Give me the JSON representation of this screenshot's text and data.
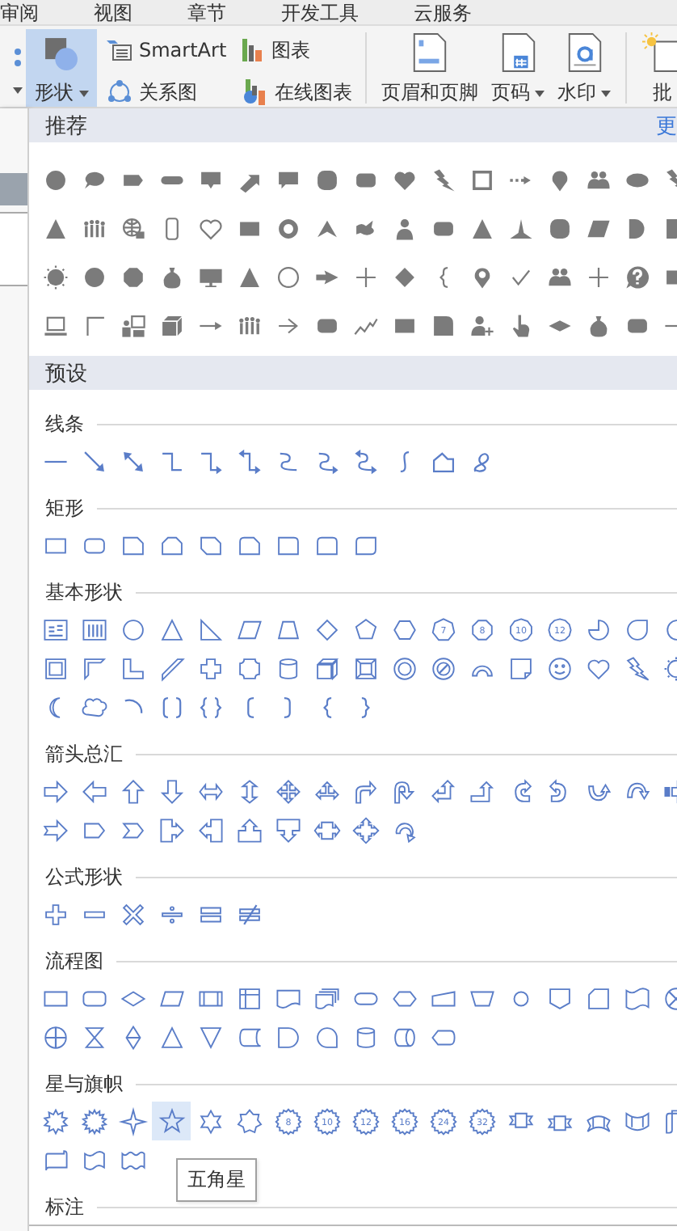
{
  "ribbon": {
    "tabs": [
      "审阅",
      "视图",
      "章节",
      "开发工具",
      "云服务"
    ],
    "shapes_button": {
      "label": "形状",
      "selected": true
    },
    "small_buttons": [
      {
        "kind": "smartart",
        "label": "SmartArt"
      },
      {
        "kind": "relation",
        "label": "关系图"
      },
      {
        "kind": "chart",
        "label": "图表"
      },
      {
        "kind": "online-chart",
        "label": "在线图表"
      }
    ],
    "large_buttons": [
      {
        "kind": "header-footer",
        "label": "页眉和页脚",
        "dropdown": false
      },
      {
        "kind": "page-number",
        "label": "页码",
        "dropdown": true
      },
      {
        "kind": "watermark",
        "label": "水印",
        "dropdown": true
      },
      {
        "kind": "comment",
        "label": "批",
        "dropdown": false
      }
    ]
  },
  "gallery": {
    "recommended": {
      "title": "推荐",
      "more": "更",
      "rows": [
        [
          {
            "kind": "circle",
            "selected": false
          },
          {
            "kind": "speech-bubble",
            "selected": false
          },
          {
            "kind": "tag",
            "selected": false
          },
          {
            "kind": "pill",
            "selected": false
          },
          {
            "kind": "square-callout",
            "selected": false
          },
          {
            "kind": "diagonal-arrow",
            "selected": false
          },
          {
            "kind": "chat-bubble",
            "selected": false
          },
          {
            "kind": "rounded-square",
            "selected": false
          },
          {
            "kind": "rounded-rect",
            "selected": false
          },
          {
            "kind": "heart",
            "selected": false
          },
          {
            "kind": "lightning",
            "selected": false
          },
          {
            "kind": "square-frame",
            "selected": false
          },
          {
            "kind": "dashed-arrow",
            "selected": false
          },
          {
            "kind": "map-pin",
            "selected": false
          },
          {
            "kind": "people",
            "selected": false
          },
          {
            "kind": "ellipse",
            "selected": false
          },
          {
            "kind": "lightning",
            "selected": false
          }
        ],
        [
          {
            "kind": "triangle",
            "selected": false
          },
          {
            "kind": "crowd",
            "selected": false
          },
          {
            "kind": "globe",
            "selected": false
          },
          {
            "kind": "phone",
            "selected": false
          },
          {
            "kind": "heart-outline",
            "selected": false
          },
          {
            "kind": "rect",
            "selected": false
          },
          {
            "kind": "ring",
            "selected": false
          },
          {
            "kind": "chevron-up",
            "selected": false
          },
          {
            "kind": "bird",
            "selected": false
          },
          {
            "kind": "person",
            "selected": false
          },
          {
            "kind": "rounded-rect",
            "selected": false
          },
          {
            "kind": "triangle",
            "selected": false
          },
          {
            "kind": "peak",
            "selected": false
          },
          {
            "kind": "rounded-square",
            "selected": false
          },
          {
            "kind": "parallelogram",
            "selected": false
          },
          {
            "kind": "half-circle",
            "selected": false
          },
          {
            "kind": "flag",
            "selected": false
          }
        ],
        [
          {
            "kind": "sun",
            "selected": false
          },
          {
            "kind": "circle",
            "selected": false
          },
          {
            "kind": "octagon",
            "selected": false
          },
          {
            "kind": "money-bag",
            "selected": false
          },
          {
            "kind": "monitor",
            "selected": false
          },
          {
            "kind": "triangle",
            "selected": false
          },
          {
            "kind": "circle-outline",
            "selected": false
          },
          {
            "kind": "thick-arrow",
            "selected": false
          },
          {
            "kind": "thin-plus",
            "selected": false
          },
          {
            "kind": "diamond",
            "selected": false
          },
          {
            "kind": "left-brace",
            "selected": false
          },
          {
            "kind": "location-pin",
            "selected": false
          },
          {
            "kind": "slanted-v",
            "selected": false
          },
          {
            "kind": "people",
            "selected": false
          },
          {
            "kind": "thin-plus",
            "selected": false
          },
          {
            "kind": "question-bubble",
            "selected": false
          },
          {
            "kind": "rect",
            "selected": false
          }
        ],
        [
          {
            "kind": "laptop",
            "selected": false
          },
          {
            "kind": "corner",
            "selected": false
          },
          {
            "kind": "presenter",
            "selected": false
          },
          {
            "kind": "cube",
            "selected": false
          },
          {
            "kind": "long-arrow",
            "selected": false
          },
          {
            "kind": "crowd",
            "selected": false
          },
          {
            "kind": "arrow-right",
            "selected": false
          },
          {
            "kind": "rounded-rect",
            "selected": false
          },
          {
            "kind": "zigzag",
            "selected": false
          },
          {
            "kind": "rect",
            "selected": false
          },
          {
            "kind": "rounded-corner-square",
            "selected": false
          },
          {
            "kind": "person-plus",
            "selected": false
          },
          {
            "kind": "pointing-hand",
            "selected": false
          },
          {
            "kind": "flat-diamond",
            "selected": false
          },
          {
            "kind": "money-bag",
            "selected": false
          },
          {
            "kind": "rounded-rect",
            "selected": false
          },
          {
            "kind": "line",
            "selected": false
          }
        ]
      ]
    },
    "preset": {
      "title": "预设",
      "sections": [
        {
          "title": "线条",
          "rows": [
            [
              {
                "kind": "line",
                "selected": false
              },
              {
                "kind": "arrow-line",
                "selected": false
              },
              {
                "kind": "double-arrow-line",
                "selected": false
              },
              {
                "kind": "elbow-connector",
                "selected": false
              },
              {
                "kind": "elbow-arrow",
                "selected": false
              },
              {
                "kind": "elbow-double-arrow",
                "selected": false
              },
              {
                "kind": "curved-connector",
                "selected": false
              },
              {
                "kind": "curved-arrow",
                "selected": false
              },
              {
                "kind": "curved-double-arrow",
                "selected": false
              },
              {
                "kind": "s-curve",
                "selected": false
              },
              {
                "kind": "freeform",
                "selected": false
              },
              {
                "kind": "scribble",
                "selected": false
              }
            ]
          ]
        },
        {
          "title": "矩形",
          "rows": [
            [
              {
                "kind": "rect",
                "selected": false
              },
              {
                "kind": "rounded-rect",
                "selected": false
              },
              {
                "kind": "snip-corner-rect",
                "selected": false
              },
              {
                "kind": "snip-top-rect",
                "selected": false
              },
              {
                "kind": "snip-diagonal-rect",
                "selected": false
              },
              {
                "kind": "snip-round-rect",
                "selected": false
              },
              {
                "kind": "round-corner-rect",
                "selected": false
              },
              {
                "kind": "round-top-rect",
                "selected": false
              },
              {
                "kind": "round-diagonal-rect",
                "selected": false
              }
            ]
          ]
        },
        {
          "title": "基本形状",
          "rows": [
            [
              {
                "kind": "text-box",
                "selected": false
              },
              {
                "kind": "vertical-text-box",
                "selected": false
              },
              {
                "kind": "circle",
                "selected": false
              },
              {
                "kind": "triangle",
                "selected": false
              },
              {
                "kind": "right-triangle",
                "selected": false
              },
              {
                "kind": "parallelogram",
                "selected": false
              },
              {
                "kind": "trapezoid",
                "selected": false
              },
              {
                "kind": "diamond",
                "selected": false
              },
              {
                "kind": "pentagon",
                "selected": false
              },
              {
                "kind": "hexagon",
                "selected": false
              },
              {
                "kind": "heptagon",
                "label": "7",
                "selected": false
              },
              {
                "kind": "octagon",
                "label": "8",
                "selected": false
              },
              {
                "kind": "decagon",
                "label": "10",
                "selected": false
              },
              {
                "kind": "dodecagon",
                "label": "12",
                "selected": false
              },
              {
                "kind": "pie",
                "selected": false
              },
              {
                "kind": "teardrop",
                "selected": false
              },
              {
                "kind": "chord",
                "selected": false
              }
            ],
            [
              {
                "kind": "frame",
                "selected": false
              },
              {
                "kind": "half-frame",
                "selected": false
              },
              {
                "kind": "l-shape",
                "selected": false
              },
              {
                "kind": "diagonal-stripe",
                "selected": false
              },
              {
                "kind": "cross",
                "selected": false
              },
              {
                "kind": "plaque",
                "selected": false
              },
              {
                "kind": "can",
                "selected": false
              },
              {
                "kind": "cube",
                "selected": false
              },
              {
                "kind": "bevel",
                "selected": false
              },
              {
                "kind": "donut",
                "selected": false
              },
              {
                "kind": "no-symbol",
                "selected": false
              },
              {
                "kind": "block-arc",
                "selected": false
              },
              {
                "kind": "folded-corner",
                "selected": false
              },
              {
                "kind": "smiley",
                "selected": false
              },
              {
                "kind": "heart",
                "selected": false
              },
              {
                "kind": "lightning",
                "selected": false
              },
              {
                "kind": "sun",
                "selected": false
              }
            ],
            [
              {
                "kind": "moon",
                "selected": false
              },
              {
                "kind": "cloud",
                "selected": false
              },
              {
                "kind": "arc",
                "selected": false
              },
              {
                "kind": "bracket-pair",
                "selected": false
              },
              {
                "kind": "brace-pair",
                "selected": false
              },
              {
                "kind": "left-bracket",
                "selected": false
              },
              {
                "kind": "right-bracket",
                "selected": false
              },
              {
                "kind": "left-brace",
                "selected": false
              },
              {
                "kind": "right-brace",
                "selected": false
              }
            ]
          ]
        },
        {
          "title": "箭头总汇",
          "rows": [
            [
              {
                "kind": "right-arrow",
                "selected": false
              },
              {
                "kind": "left-arrow",
                "selected": false
              },
              {
                "kind": "up-arrow",
                "selected": false
              },
              {
                "kind": "down-arrow",
                "selected": false
              },
              {
                "kind": "left-right-arrow",
                "selected": false
              },
              {
                "kind": "up-down-arrow",
                "selected": false
              },
              {
                "kind": "quad-arrow",
                "selected": false
              },
              {
                "kind": "left-right-up-arrow",
                "selected": false
              },
              {
                "kind": "bent-arrow",
                "selected": false
              },
              {
                "kind": "u-turn-arrow",
                "selected": false
              },
              {
                "kind": "left-up-arrow",
                "selected": false
              },
              {
                "kind": "bent-up-arrow",
                "selected": false
              },
              {
                "kind": "curved-right-arrow",
                "selected": false
              },
              {
                "kind": "curved-left-arrow",
                "selected": false
              },
              {
                "kind": "curved-up-arrow",
                "selected": false
              },
              {
                "kind": "curved-down-arrow",
                "selected": false
              },
              {
                "kind": "striped-right-arrow",
                "selected": false
              }
            ],
            [
              {
                "kind": "notched-right-arrow",
                "selected": false
              },
              {
                "kind": "pentagon-arrow",
                "selected": false
              },
              {
                "kind": "chevron",
                "selected": false
              },
              {
                "kind": "right-arrow-callout",
                "selected": false
              },
              {
                "kind": "left-arrow-callout",
                "selected": false
              },
              {
                "kind": "up-arrow-callout",
                "selected": false
              },
              {
                "kind": "down-arrow-callout",
                "selected": false
              },
              {
                "kind": "left-right-arrow-callout",
                "selected": false
              },
              {
                "kind": "quad-arrow-callout",
                "selected": false
              },
              {
                "kind": "circular-arrow",
                "selected": false
              }
            ]
          ]
        },
        {
          "title": "公式形状",
          "rows": [
            [
              {
                "kind": "plus-sign",
                "selected": false
              },
              {
                "kind": "minus-sign",
                "selected": false
              },
              {
                "kind": "multiply-sign",
                "selected": false
              },
              {
                "kind": "divide-sign",
                "selected": false
              },
              {
                "kind": "equal-sign",
                "selected": false
              },
              {
                "kind": "not-equal-sign",
                "selected": false
              }
            ]
          ]
        },
        {
          "title": "流程图",
          "rows": [
            [
              {
                "kind": "process",
                "selected": false
              },
              {
                "kind": "alternate-process",
                "selected": false
              },
              {
                "kind": "decision",
                "selected": false
              },
              {
                "kind": "data",
                "selected": false
              },
              {
                "kind": "predefined-process",
                "selected": false
              },
              {
                "kind": "internal-storage",
                "selected": false
              },
              {
                "kind": "document",
                "selected": false
              },
              {
                "kind": "multidocument",
                "selected": false
              },
              {
                "kind": "terminator",
                "selected": false
              },
              {
                "kind": "preparation",
                "selected": false
              },
              {
                "kind": "manual-input",
                "selected": false
              },
              {
                "kind": "manual-operation",
                "selected": false
              },
              {
                "kind": "connector",
                "selected": false
              },
              {
                "kind": "off-page-connector",
                "selected": false
              },
              {
                "kind": "punched-card",
                "selected": false
              },
              {
                "kind": "punched-tape",
                "selected": false
              },
              {
                "kind": "summing-junction",
                "selected": false
              }
            ],
            [
              {
                "kind": "or-symbol",
                "selected": false
              },
              {
                "kind": "collate",
                "selected": false
              },
              {
                "kind": "sort",
                "selected": false
              },
              {
                "kind": "extract",
                "selected": false
              },
              {
                "kind": "merge",
                "selected": false
              },
              {
                "kind": "stored-data",
                "selected": false
              },
              {
                "kind": "delay",
                "selected": false
              },
              {
                "kind": "sequential-storage",
                "selected": false
              },
              {
                "kind": "magnetic-disk",
                "selected": false
              },
              {
                "kind": "direct-access-storage",
                "selected": false
              },
              {
                "kind": "display",
                "selected": false
              }
            ]
          ]
        },
        {
          "title": "星与旗帜",
          "rows": [
            [
              {
                "kind": "explosion",
                "selected": false
              },
              {
                "kind": "jagged-explosion",
                "selected": false
              },
              {
                "kind": "four-point-star",
                "selected": false
              },
              {
                "kind": "five-point-star",
                "selected": true
              },
              {
                "kind": "six-point-star",
                "selected": false
              },
              {
                "kind": "seven-point-star",
                "selected": false
              },
              {
                "kind": "star-badge",
                "label": "8",
                "selected": false
              },
              {
                "kind": "star-badge",
                "label": "10",
                "selected": false
              },
              {
                "kind": "star-badge",
                "label": "12",
                "selected": false
              },
              {
                "kind": "star-badge",
                "label": "16",
                "selected": false
              },
              {
                "kind": "star-badge",
                "label": "24",
                "selected": false
              },
              {
                "kind": "star-badge",
                "label": "32",
                "selected": false
              },
              {
                "kind": "ribbon-down",
                "selected": false
              },
              {
                "kind": "ribbon-up",
                "selected": false
              },
              {
                "kind": "curved-ribbon-down",
                "selected": false
              },
              {
                "kind": "curved-ribbon-up",
                "selected": false
              },
              {
                "kind": "vertical-scroll",
                "selected": false
              }
            ],
            [
              {
                "kind": "horizontal-scroll",
                "selected": false
              },
              {
                "kind": "wave",
                "selected": false
              },
              {
                "kind": "double-wave",
                "selected": false
              }
            ]
          ]
        },
        {
          "title": "标注"
        }
      ]
    },
    "tooltip": "五角星"
  }
}
